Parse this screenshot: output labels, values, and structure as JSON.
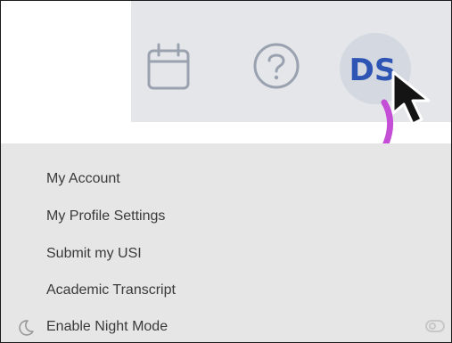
{
  "header": {
    "calendar_icon": "calendar-icon",
    "help_icon": "help-circle-icon",
    "avatar_initials": "DS",
    "avatar_color": "#2f55b4",
    "bar_color": "#e4e6ea"
  },
  "annotation": {
    "cursor": "mouse-pointer-icon",
    "arrow_color": "#c44ed6"
  },
  "menu": {
    "items": [
      {
        "label": "My Account"
      },
      {
        "label": "My Profile Settings"
      },
      {
        "label": "Submit my USI"
      },
      {
        "label": "Academic Transcript"
      }
    ],
    "night_mode": {
      "label": "Enable Night Mode",
      "icon": "moon-icon",
      "enabled": false
    }
  }
}
